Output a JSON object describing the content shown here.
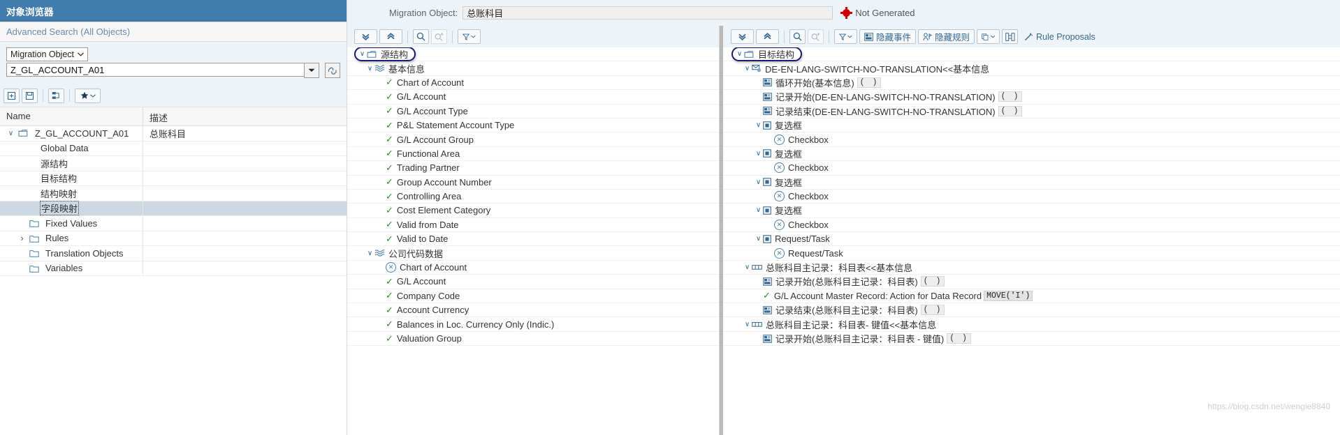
{
  "left": {
    "title": "对象浏览器",
    "search_placeholder": "Advanced Search (All Objects)",
    "filter_type": "Migration Object",
    "filter_value": "Z_GL_ACCOUNT_A01",
    "toolbar": [
      {
        "name": "new-object-button",
        "label": ""
      },
      {
        "name": "save-object-button",
        "label": ""
      },
      {
        "name": "hierarchy-button",
        "label": ""
      },
      {
        "name": "favorites-button",
        "label": ""
      }
    ],
    "columns": [
      "Name",
      "描述"
    ],
    "rows": [
      {
        "label": "Z_GL_ACCOUNT_A01",
        "desc": "总账科目",
        "indent": 0,
        "arrow": "expanded",
        "icon": "object-icon",
        "selected": false
      },
      {
        "label": "Global Data",
        "desc": "",
        "indent": 2,
        "arrow": "none",
        "icon": "",
        "selected": false
      },
      {
        "label": "源结构",
        "desc": "",
        "indent": 2,
        "arrow": "none",
        "icon": "",
        "selected": false
      },
      {
        "label": "目标结构",
        "desc": "",
        "indent": 2,
        "arrow": "none",
        "icon": "",
        "selected": false
      },
      {
        "label": "结构映射",
        "desc": "",
        "indent": 2,
        "arrow": "none",
        "icon": "",
        "selected": false
      },
      {
        "label": "字段映射",
        "desc": "",
        "indent": 2,
        "arrow": "none",
        "icon": "",
        "selected": true
      },
      {
        "label": "Fixed Values",
        "desc": "",
        "indent": 1,
        "arrow": "none",
        "icon": "folder-icon",
        "selected": false
      },
      {
        "label": "Rules",
        "desc": "",
        "indent": 1,
        "arrow": "collapsed",
        "icon": "folder-icon",
        "selected": false
      },
      {
        "label": "Translation Objects",
        "desc": "",
        "indent": 1,
        "arrow": "none",
        "icon": "folder-icon",
        "selected": false
      },
      {
        "label": "Variables",
        "desc": "",
        "indent": 1,
        "arrow": "none",
        "icon": "folder-icon",
        "selected": false
      }
    ]
  },
  "header": {
    "migration_object_label": "Migration Object:",
    "migration_object_value": "总账科目",
    "status_text": "Not Generated",
    "status_color": "#d00000"
  },
  "center_pane": {
    "toolbar": [
      {
        "name": "expand-all-button",
        "label": ""
      },
      {
        "name": "collapse-all-button",
        "label": ""
      },
      {
        "name": "search-button",
        "label": ""
      },
      {
        "name": "search-add-button",
        "label": ""
      },
      {
        "name": "filter-button",
        "label": ""
      }
    ],
    "nodes": [
      {
        "label": "源结构",
        "indent": 0,
        "arrow": "expanded",
        "icon": "structure-icon",
        "highlight": true
      },
      {
        "label": "基本信息",
        "indent": 1,
        "arrow": "expanded",
        "icon": "wave-icon"
      },
      {
        "label": "Chart of Account",
        "indent": 2,
        "arrow": "none",
        "icon": "check-icon"
      },
      {
        "label": "G/L Account",
        "indent": 2,
        "arrow": "none",
        "icon": "check-icon"
      },
      {
        "label": "G/L Account Type",
        "indent": 2,
        "arrow": "none",
        "icon": "check-icon"
      },
      {
        "label": "P&L Statement Account Type",
        "indent": 2,
        "arrow": "none",
        "icon": "check-icon"
      },
      {
        "label": "G/L Account Group",
        "indent": 2,
        "arrow": "none",
        "icon": "check-icon"
      },
      {
        "label": "Functional Area",
        "indent": 2,
        "arrow": "none",
        "icon": "check-icon"
      },
      {
        "label": "Trading Partner",
        "indent": 2,
        "arrow": "none",
        "icon": "check-icon"
      },
      {
        "label": "Group Account Number",
        "indent": 2,
        "arrow": "none",
        "icon": "check-icon"
      },
      {
        "label": "Controlling Area",
        "indent": 2,
        "arrow": "none",
        "icon": "check-icon"
      },
      {
        "label": "Cost Element Category",
        "indent": 2,
        "arrow": "none",
        "icon": "check-icon"
      },
      {
        "label": "Valid from Date",
        "indent": 2,
        "arrow": "none",
        "icon": "check-icon"
      },
      {
        "label": "Valid to Date",
        "indent": 2,
        "arrow": "none",
        "icon": "check-icon"
      },
      {
        "label": "公司代码数据",
        "indent": 1,
        "arrow": "expanded",
        "icon": "wave-icon"
      },
      {
        "label": "Chart of Account",
        "indent": 2,
        "arrow": "none",
        "icon": "xcircle-icon"
      },
      {
        "label": "G/L Account",
        "indent": 2,
        "arrow": "none",
        "icon": "check-icon"
      },
      {
        "label": "Company Code",
        "indent": 2,
        "arrow": "none",
        "icon": "check-icon"
      },
      {
        "label": "Account Currency",
        "indent": 2,
        "arrow": "none",
        "icon": "check-icon"
      },
      {
        "label": "Balances in Loc. Currency Only (Indic.)",
        "indent": 2,
        "arrow": "none",
        "icon": "check-icon"
      },
      {
        "label": "Valuation Group",
        "indent": 2,
        "arrow": "none",
        "icon": "check-icon"
      }
    ]
  },
  "right_pane": {
    "toolbar": [
      {
        "name": "expand-all-button",
        "label": ""
      },
      {
        "name": "collapse-all-button",
        "label": ""
      },
      {
        "name": "search-button",
        "label": ""
      },
      {
        "name": "search-add-button",
        "label": ""
      },
      {
        "name": "filter-button",
        "label": ""
      },
      {
        "name": "hide-events-button",
        "label": "隐藏事件"
      },
      {
        "name": "hide-rules-button",
        "label": "隐藏规则"
      },
      {
        "name": "copy-button",
        "label": ""
      },
      {
        "name": "transform-button",
        "label": ""
      },
      {
        "name": "rule-proposals-button",
        "label": "Rule Proposals"
      }
    ],
    "nodes": [
      {
        "label": "目标结构",
        "indent": 0,
        "arrow": "expanded",
        "icon": "structure-icon",
        "highlight": true
      },
      {
        "label": "DE-EN-LANG-SWITCH-NO-TRANSLATION<<基本信息",
        "indent": 1,
        "arrow": "expanded",
        "icon": "event-icon"
      },
      {
        "label": "循环开始(基本信息)",
        "indent": 2,
        "arrow": "none",
        "icon": "rule-icon",
        "suffix": "( )"
      },
      {
        "label": "记录开始(DE-EN-LANG-SWITCH-NO-TRANSLATION)",
        "indent": 2,
        "arrow": "none",
        "icon": "rule-icon",
        "suffix": "( )"
      },
      {
        "label": "记录结束(DE-EN-LANG-SWITCH-NO-TRANSLATION)",
        "indent": 2,
        "arrow": "none",
        "icon": "rule-icon",
        "suffix": "( )"
      },
      {
        "label": "复选框",
        "indent": 2,
        "arrow": "expanded",
        "icon": "field-icon"
      },
      {
        "label": "Checkbox",
        "indent": 3,
        "arrow": "none",
        "icon": "xcircle-icon"
      },
      {
        "label": "复选框",
        "indent": 2,
        "arrow": "expanded",
        "icon": "field-icon"
      },
      {
        "label": "Checkbox",
        "indent": 3,
        "arrow": "none",
        "icon": "xcircle-icon"
      },
      {
        "label": "复选框",
        "indent": 2,
        "arrow": "expanded",
        "icon": "field-icon"
      },
      {
        "label": "Checkbox",
        "indent": 3,
        "arrow": "none",
        "icon": "xcircle-icon"
      },
      {
        "label": "复选框",
        "indent": 2,
        "arrow": "expanded",
        "icon": "field-icon"
      },
      {
        "label": "Checkbox",
        "indent": 3,
        "arrow": "none",
        "icon": "xcircle-icon"
      },
      {
        "label": "Request/Task",
        "indent": 2,
        "arrow": "expanded",
        "icon": "field-icon"
      },
      {
        "label": "Request/Task",
        "indent": 3,
        "arrow": "none",
        "icon": "xcircle-icon"
      },
      {
        "label": "总账科目主记录：科目表<<基本信息",
        "indent": 1,
        "arrow": "expanded",
        "icon": "table-icon"
      },
      {
        "label": "记录开始(总账科目主记录：科目表)",
        "indent": 2,
        "arrow": "none",
        "icon": "rule-icon",
        "suffix": "( )"
      },
      {
        "label": "G/L Account Master Record: Action for Data Record",
        "indent": 2,
        "arrow": "none",
        "icon": "check-icon",
        "code": "MOVE('I')"
      },
      {
        "label": "记录结束(总账科目主记录：科目表)",
        "indent": 2,
        "arrow": "none",
        "icon": "rule-icon",
        "suffix": "( )"
      },
      {
        "label": "总账科目主记录：科目表- 键值<<基本信息",
        "indent": 1,
        "arrow": "expanded",
        "icon": "table-icon"
      },
      {
        "label": "记录开始(总账科目主记录：科目表 - 键值)",
        "indent": 2,
        "arrow": "none",
        "icon": "rule-icon",
        "suffix": "( )"
      }
    ]
  },
  "watermark": "https://blog.csdn.net/wengie8840"
}
